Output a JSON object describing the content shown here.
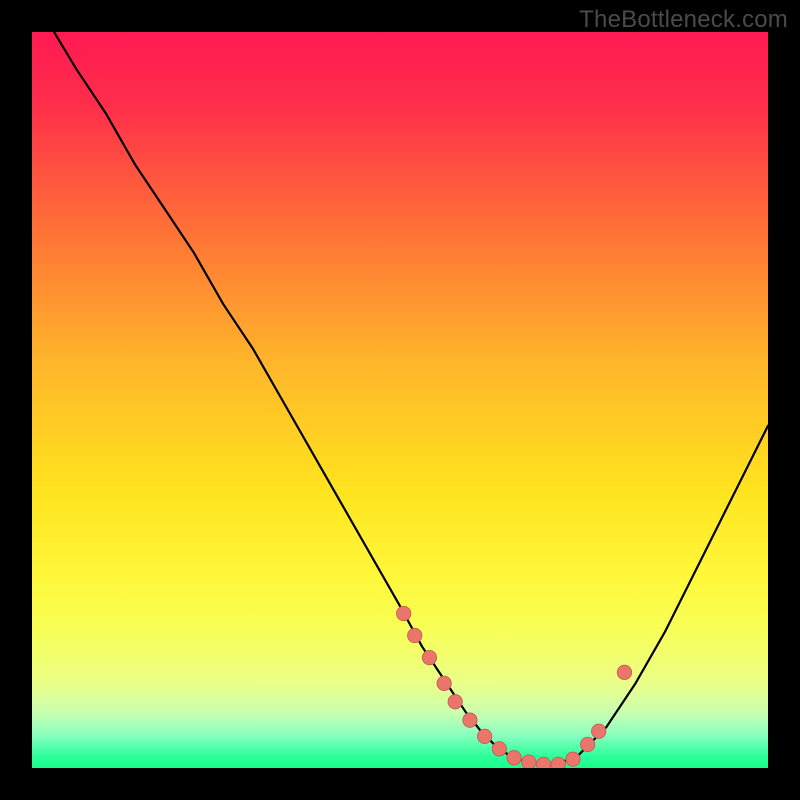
{
  "watermark": "TheBottleneck.com",
  "colors": {
    "background": "#000000",
    "gradient_stops": [
      {
        "offset": 0.0,
        "color": "#ff1a53"
      },
      {
        "offset": 0.1,
        "color": "#ff2e4a"
      },
      {
        "offset": 0.25,
        "color": "#ff6a38"
      },
      {
        "offset": 0.45,
        "color": "#ffb62a"
      },
      {
        "offset": 0.62,
        "color": "#ffe31e"
      },
      {
        "offset": 0.74,
        "color": "#fff83a"
      },
      {
        "offset": 0.82,
        "color": "#f6ff5a"
      },
      {
        "offset": 0.885,
        "color": "#eaff88"
      },
      {
        "offset": 0.925,
        "color": "#c9ffb0"
      },
      {
        "offset": 0.955,
        "color": "#8affc0"
      },
      {
        "offset": 0.985,
        "color": "#2aff9a"
      },
      {
        "offset": 1.0,
        "color": "#1aff8a"
      }
    ],
    "curve": "#000000",
    "marker_fill": "#e9756b",
    "marker_stroke": "#c25a52"
  },
  "chart_data": {
    "type": "line",
    "title": "",
    "xlabel": "",
    "ylabel": "",
    "xlim": [
      0,
      100
    ],
    "ylim": [
      0,
      100
    ],
    "grid": false,
    "legend": false,
    "series": [
      {
        "name": "curve",
        "x": [
          3,
          6,
          10,
          14,
          18,
          22,
          26,
          30,
          34,
          38,
          42,
          46,
          50,
          53,
          55,
          57,
          59,
          61,
          63,
          65,
          67,
          69,
          71,
          74,
          78,
          82,
          86,
          90,
          94,
          98,
          100
        ],
        "y": [
          100,
          95,
          89,
          82,
          76,
          70,
          63,
          57,
          50,
          43,
          36,
          29,
          22,
          16.5,
          13.5,
          10.5,
          7.5,
          5.0,
          3.0,
          1.6,
          0.9,
          0.5,
          0.5,
          1.5,
          5.5,
          11.5,
          18.5,
          26.5,
          34.5,
          42.5,
          46.5
        ]
      }
    ],
    "markers": {
      "name": "highlight-points",
      "x": [
        50.5,
        52.0,
        54.0,
        56.0,
        57.5,
        59.5,
        61.5,
        63.5,
        65.5,
        67.5,
        69.5,
        71.5,
        73.5,
        75.5,
        77.0,
        80.5
      ],
      "y": [
        21.0,
        18.0,
        15.0,
        11.5,
        9.0,
        6.5,
        4.3,
        2.6,
        1.4,
        0.8,
        0.5,
        0.5,
        1.2,
        3.2,
        5.0,
        13.0
      ]
    }
  }
}
